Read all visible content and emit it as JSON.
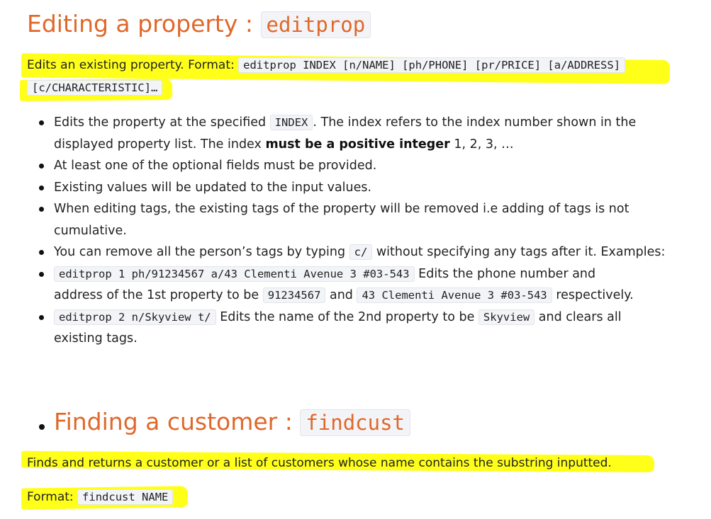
{
  "section1": {
    "heading": "Editing a property : ",
    "heading_code": "editprop",
    "desc_text": "Edits an existing property. Format: ",
    "format_code": "editprop INDEX [n/NAME] [ph/PHONE] [pr/PRICE] [a/ADDRESS]",
    "format_code2": "[c/CHARACTERISTIC]…",
    "bullets": {
      "b1_a": "Edits the property at the specified ",
      "b1_code": "INDEX",
      "b1_b": ". The index refers to the index number shown in the",
      "b1_c": "displayed property list. The index ",
      "b1_bold": "must be a positive integer",
      "b1_d": " 1, 2, 3, …",
      "b2": "At least one of the optional fields must be provided.",
      "b3": "Existing values will be updated to the input values.",
      "b4_a": "When editing tags, the existing tags of the property will be removed i.e adding of tags is not",
      "b4_b": "cumulative.",
      "b5_a": "You can remove all the person’s tags by typing ",
      "b5_code": "c/",
      "b5_b": " without specifying any tags after it. Examples:",
      "b6_code": "editprop 1 ph/91234567 a/43 Clementi Avenue 3 #03-543",
      "b6_a": " Edits the phone number and",
      "b6_b": "address of the 1st property to be ",
      "b6_code2": "91234567",
      "b6_c": " and ",
      "b6_code3": "43 Clementi Avenue 3 #03-543",
      "b6_d": " respectively.",
      "b7_code": "editprop 2 n/Skyview t/",
      "b7_a": " Edits the name of the 2nd property to be ",
      "b7_code2": "Skyview",
      "b7_b": " and clears all",
      "b7_c": "existing tags."
    }
  },
  "section2": {
    "heading": "Finding a customer : ",
    "heading_code": "findcust",
    "desc_text": "Finds and returns a customer or a list of customers whose name contains the substring inputted.",
    "format_label": "Format: ",
    "format_code": "findcust NAME"
  },
  "colors": {
    "heading": "#e0682a",
    "highlight": "#ffff1a"
  }
}
